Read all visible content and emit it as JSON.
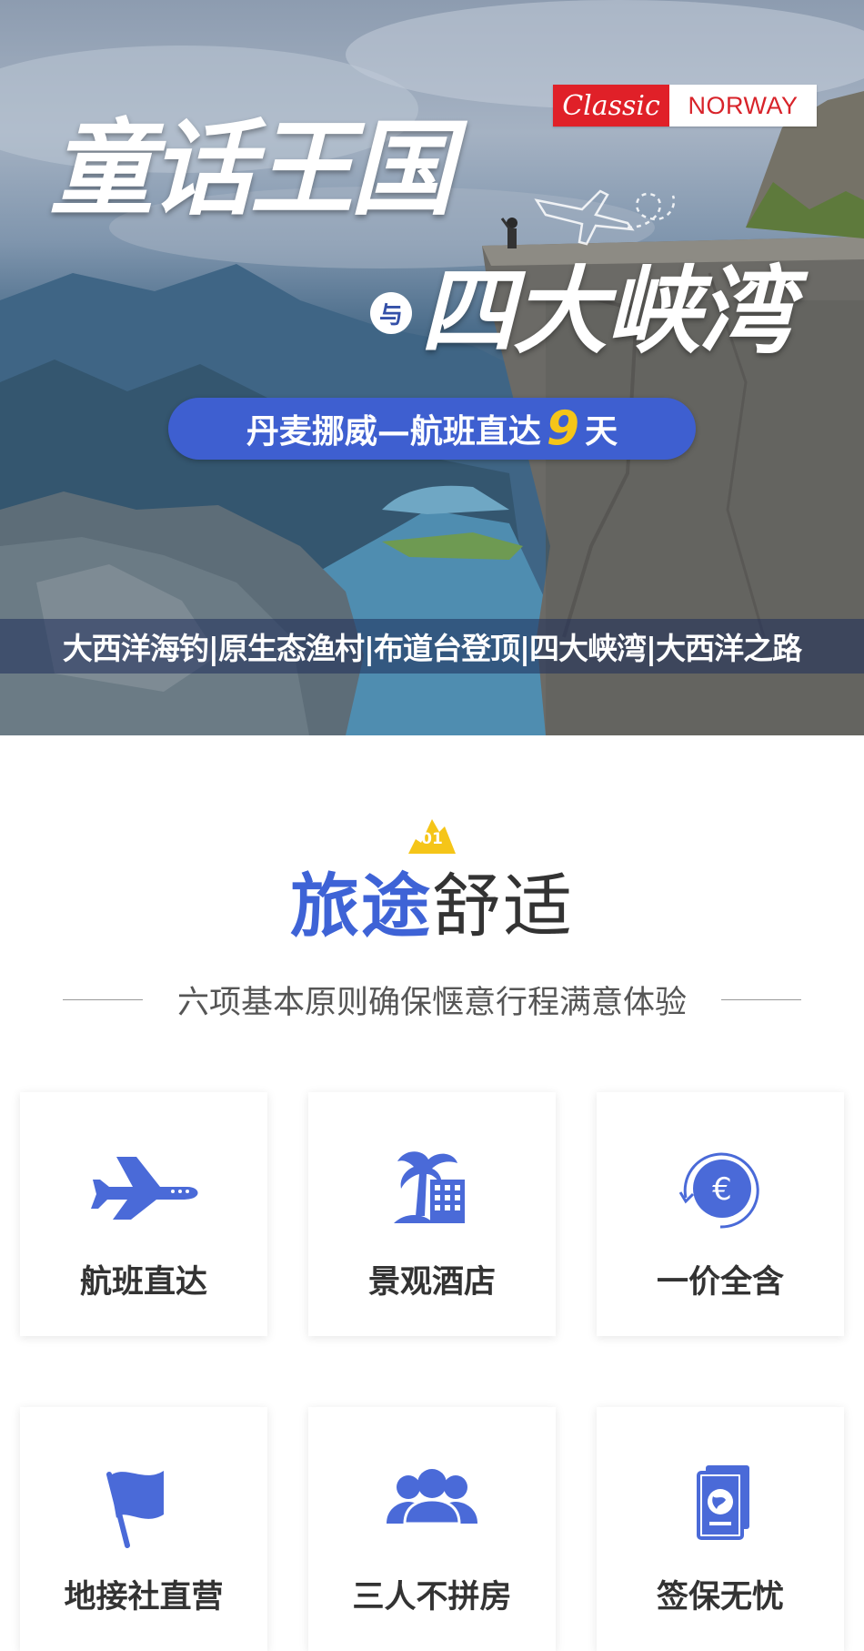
{
  "hero": {
    "badge_classic": "Classic",
    "badge_norway": "NORWAY",
    "title_line1": "童话王国",
    "connector": "与",
    "title_line2": "四大峡湾",
    "pill_prefix": "丹麦挪威—航班直达",
    "pill_days": "9",
    "pill_suffix": "天",
    "highlights": "大西洋海钓|原生态渔村|布道台登顶|四大峡湾|大西洋之路"
  },
  "section": {
    "number": "01",
    "title_accent": "旅途",
    "title_rest": "舒适",
    "subtitle": "六项基本原则确保惬意行程满意体验"
  },
  "features": [
    {
      "label": "航班直达",
      "icon": "airplane-icon"
    },
    {
      "label": "景观酒店",
      "icon": "palm-hotel-icon"
    },
    {
      "label": "一价全含",
      "icon": "euro-coin-icon"
    },
    {
      "label": "地接社直营",
      "icon": "flag-icon"
    },
    {
      "label": "三人不拼房",
      "icon": "group-people-icon"
    },
    {
      "label": "签保无忧",
      "icon": "passport-icon"
    }
  ],
  "colors": {
    "accent": "#3e63d6",
    "pill": "#3e5fd0",
    "days": "#f5c518",
    "badge_red": "#e02028",
    "section_badge": "#f5c518"
  }
}
